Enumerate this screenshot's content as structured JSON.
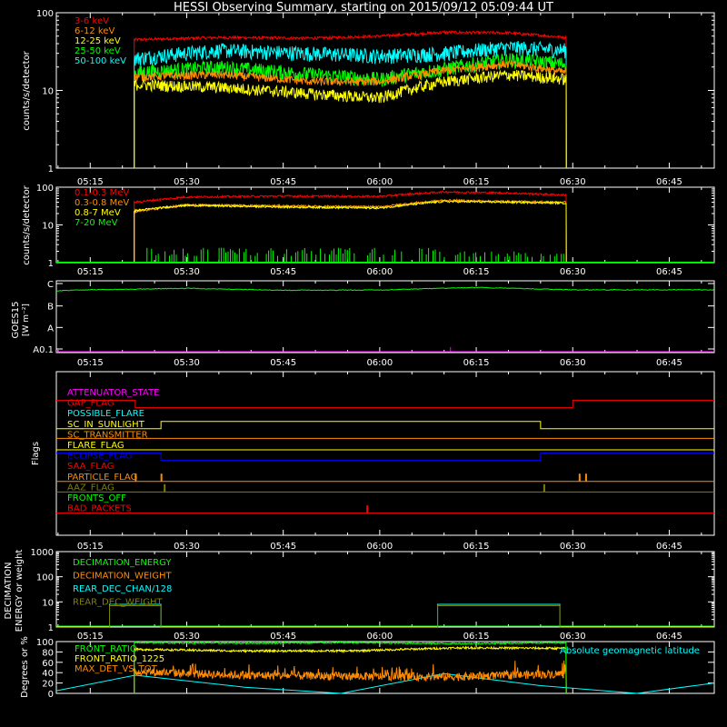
{
  "title": "HESSI Observing Summary, starting on 2015/09/12 05:09:44 UT",
  "time_ticks": [
    "05:15",
    "05:30",
    "05:45",
    "06:00",
    "06:15",
    "06:30",
    "06:45"
  ],
  "chart_data": [
    {
      "id": "lightcurves_low",
      "type": "line",
      "ylabel": "counts/s/detector",
      "yscale": "log",
      "ylim": [
        1,
        100
      ],
      "yticks": [
        "1",
        "10",
        "100"
      ],
      "xlim": [
        "05:09:44",
        "06:52"
      ],
      "data_start": "05:21:50",
      "data_end": "06:29:00",
      "legend_position": "top-left",
      "series": [
        {
          "name": "3-6 keV",
          "color": "#ff0000",
          "x": [
            "05:22",
            "05:35",
            "05:50",
            "06:00",
            "06:10",
            "06:20",
            "06:29"
          ],
          "values": [
            45,
            48,
            47,
            50,
            56,
            55,
            48
          ]
        },
        {
          "name": "6-12 keV",
          "color": "#ff8c00",
          "x": [
            "05:22",
            "05:35",
            "05:50",
            "06:00",
            "06:10",
            "06:20",
            "06:29"
          ],
          "values": [
            15,
            16,
            13,
            13,
            18,
            22,
            17
          ]
        },
        {
          "name": "12-25 keV",
          "color": "#ffff00",
          "x": [
            "05:22",
            "05:35",
            "05:50",
            "06:00",
            "06:10",
            "06:20",
            "06:29"
          ],
          "values": [
            12,
            11,
            9,
            8,
            13,
            16,
            14
          ]
        },
        {
          "name": "25-50 keV",
          "color": "#00ff00",
          "x": [
            "05:22",
            "05:35",
            "05:50",
            "06:00",
            "06:10",
            "06:20",
            "06:29"
          ],
          "values": [
            17,
            20,
            16,
            14,
            19,
            25,
            22
          ]
        },
        {
          "name": "50-100 keV",
          "color": "#00ffff",
          "x": [
            "05:22",
            "05:35",
            "05:50",
            "06:00",
            "06:10",
            "06:20",
            "06:29"
          ],
          "values": [
            26,
            33,
            30,
            28,
            30,
            36,
            33
          ]
        }
      ]
    },
    {
      "id": "lightcurves_high",
      "type": "line",
      "ylabel": "counts/s/detector",
      "yscale": "log",
      "ylim": [
        1,
        100
      ],
      "yticks": [
        "1",
        "10",
        "100"
      ],
      "legend_position": "top-left",
      "series": [
        {
          "name": "0.1-0.3 MeV",
          "color": "#ff0000",
          "x": [
            "05:22",
            "05:30",
            "05:45",
            "06:00",
            "06:10",
            "06:20",
            "06:29"
          ],
          "values": [
            40,
            55,
            58,
            57,
            75,
            70,
            62
          ]
        },
        {
          "name": "0.3-0.8 MeV",
          "color": "#ff8c00",
          "x": [
            "05:22",
            "05:30",
            "05:45",
            "06:00",
            "06:10",
            "06:20",
            "06:29"
          ],
          "values": [
            22,
            34,
            32,
            30,
            45,
            42,
            40
          ]
        },
        {
          "name": "0.8-7 MeV",
          "color": "#ffff00",
          "x": [
            "05:22",
            "05:30",
            "05:45",
            "06:00",
            "06:10",
            "06:20",
            "06:29"
          ],
          "values": [
            24,
            33,
            30,
            28,
            42,
            40,
            38
          ]
        },
        {
          "name": "7-20 MeV",
          "color": "#00ff00",
          "x": [
            "05:22",
            "05:30",
            "05:45",
            "06:00",
            "06:10",
            "06:20",
            "06:29"
          ],
          "values": [
            1.5,
            1.5,
            1,
            1,
            1.5,
            1.8,
            1.5
          ]
        }
      ]
    },
    {
      "id": "goes",
      "type": "line",
      "ylabel": "GOES15",
      "ylabel2": "[W m⁻²]",
      "yticks": [
        "A0.1",
        "A",
        "B",
        "C"
      ],
      "series": [
        {
          "name": "GOES",
          "color": "#00ff00",
          "x": [
            "05:09",
            "05:15",
            "05:30",
            "05:45",
            "06:00",
            "06:15",
            "06:30",
            "06:52"
          ],
          "values": [
            3.7,
            3.75,
            3.82,
            3.73,
            3.74,
            3.86,
            3.75,
            3.75
          ]
        }
      ]
    },
    {
      "id": "flags",
      "type": "line",
      "ylabel": "Flags",
      "flags": [
        {
          "name": "ATTENUATOR_STATE",
          "color": "#ff00ff"
        },
        {
          "name": "GAP_FLAG",
          "color": "#ff0000"
        },
        {
          "name": "POSSIBLE_FLARE",
          "color": "#00ffff"
        },
        {
          "name": "SC_IN_SUNLIGHT",
          "color": "#ffff00"
        },
        {
          "name": "SC_TRANSMITTER",
          "color": "#ff8c00"
        },
        {
          "name": "FLARE_FLAG",
          "color": "#ffff00"
        },
        {
          "name": "ECLIPSE_FLAG",
          "color": "#0000ff"
        },
        {
          "name": "SAA_FLAG",
          "color": "#ff0000"
        },
        {
          "name": "PARTICLE_FLAG",
          "color": "#ff8c00"
        },
        {
          "name": "AAZ_FLAG",
          "color": "#808000"
        },
        {
          "name": "FRONTS_OFF",
          "color": "#00ff00"
        },
        {
          "name": "BAD_PACKETS",
          "color": "#ff0000"
        }
      ]
    },
    {
      "id": "decimation",
      "type": "line",
      "ylabel": "DECIMATION",
      "ylabel2": "ENERGY or weight",
      "yscale": "log",
      "ylim": [
        1,
        1000
      ],
      "yticks": [
        "1",
        "10",
        "100",
        "1000"
      ],
      "series": [
        {
          "name": "DECIMATION_ENERGY",
          "color": "#00ff00"
        },
        {
          "name": "DECIMATION_WEIGHT",
          "color": "#ff8c00"
        },
        {
          "name": "REAR_DEC_CHAN/128",
          "color": "#00ffff"
        },
        {
          "name": "REAR_DEC_WEIGHT",
          "color": "#808000"
        }
      ]
    },
    {
      "id": "ratios",
      "type": "line",
      "ylabel": "Degrees or %",
      "ylim": [
        0,
        100
      ],
      "yticks": [
        "0",
        "20",
        "40",
        "60",
        "80",
        "100"
      ],
      "annotation": "Absolute geomagnetic latitude",
      "series": [
        {
          "name": "FRONT_RATIO",
          "color": "#00ff00",
          "values": [
            98,
            97,
            98,
            96,
            98
          ]
        },
        {
          "name": "FRONT_RATIO_1225",
          "color": "#ffff00",
          "values": [
            85,
            82,
            82,
            88,
            87
          ]
        },
        {
          "name": "MAX_DET_VS_TOT",
          "color": "#ff8c00",
          "values": [
            42,
            35,
            33,
            32,
            38
          ]
        },
        {
          "name": "Absolute geomagnetic latitude",
          "color": "#00ffff"
        }
      ]
    }
  ]
}
